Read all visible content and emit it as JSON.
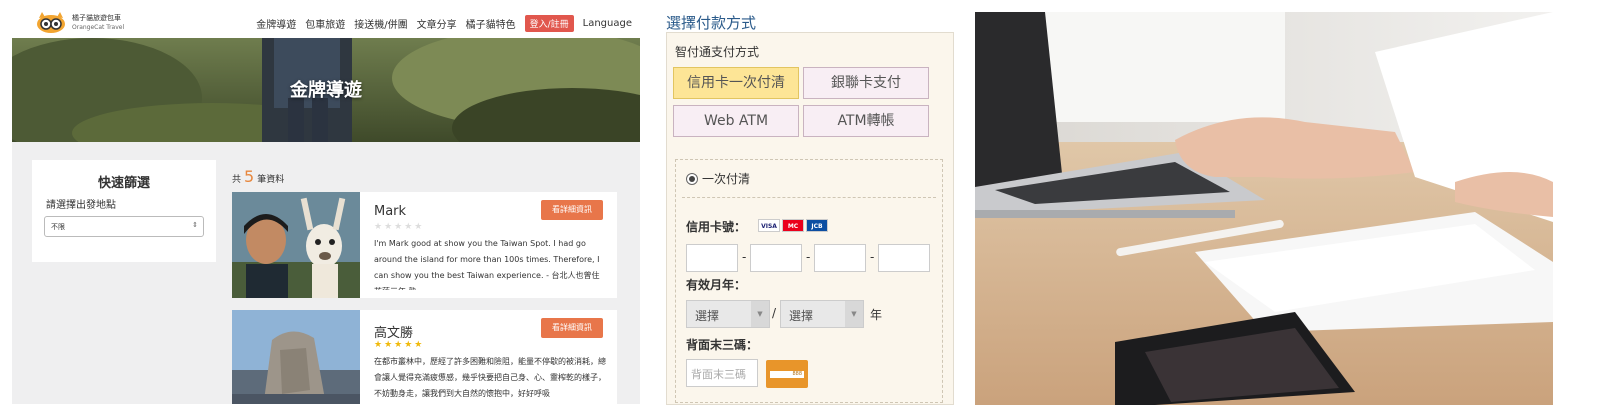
{
  "panel1": {
    "brand": {
      "name_zh": "橘子貓旅遊包車",
      "name_en": "OrangeCat Travel"
    },
    "nav": {
      "items": [
        "金牌導遊",
        "包車旅遊",
        "接送機/併團",
        "文章分享",
        "橘子貓特色"
      ],
      "login": "登入/註冊",
      "language": "Language"
    },
    "hero_title": "金牌導遊",
    "filter": {
      "title": "快速篩選",
      "label": "請選擇出發地點",
      "selected": "不限",
      "arrow": "⇕"
    },
    "results": {
      "prefix": "共",
      "count": "5",
      "suffix": "筆資料"
    },
    "cards": [
      {
        "name": "Mark",
        "stars": "★★★★★",
        "button": "看詳細資訊",
        "desc": "I'm Mark good at show you the Taiwan Spot. I had go around the island for more than 100s times. Therefore, I can show you the best Taiwan experience. - 台北人也曾住花蓮三年,熟"
      },
      {
        "name": "高文勝",
        "stars": "★★★★★",
        "button": "看詳細資訊",
        "desc": "在都市叢林中，歷經了許多困難和險阻，能量不停歇的被消耗，總會讓人覺得充滿疲憊感，幾乎快要把自己身、心、靈榨乾的樣子，不妨動身走，讓我們到大自然的懷抱中，好好呼吸"
      }
    ]
  },
  "panel2": {
    "title": "選擇付款方式",
    "subtitle": "智付通支付方式",
    "tabs": [
      "信用卡一次付清",
      "銀聯卡支付",
      "Web ATM",
      "ATM轉帳"
    ],
    "radio_label": "一次付清",
    "card_number_label": "信用卡號：",
    "card_brands": [
      "VISA",
      "MC",
      "JCB"
    ],
    "expiry_label": "有效月年：",
    "month_select": "選擇",
    "year_select": "選擇",
    "year_suffix": "年",
    "cvv_label": "背面末三碼：",
    "cvv_placeholder": "背面末三碼",
    "cvv_sample": "888",
    "accent_color": "#fde596"
  }
}
